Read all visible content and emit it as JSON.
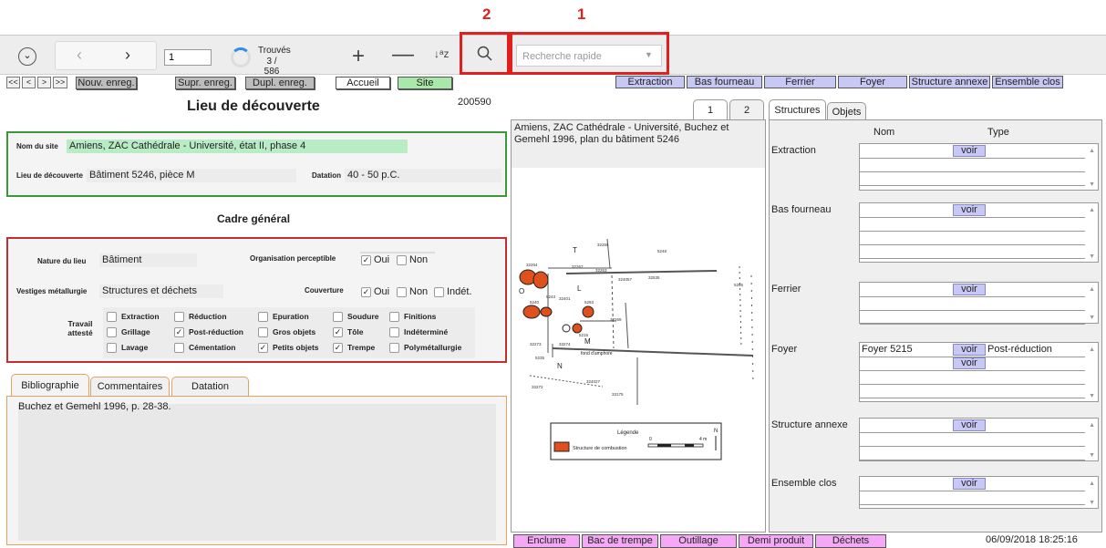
{
  "annotations": {
    "one": "1",
    "two": "2"
  },
  "toolbar": {
    "record_number": "1",
    "found_label": "Trouvés",
    "found_count": "3 / 586",
    "search_placeholder": "Recherche rapide",
    "sort_glyph": "↓ᵃz"
  },
  "nav": {
    "first": "<<",
    "prev": "<",
    "next": ">",
    "last": ">>"
  },
  "buttons": {
    "new": "Nouv. enreg.",
    "delete": "Supr. enreg.",
    "duplicate": "Dupl. enreg.",
    "home": "Accueil",
    "site": "Site"
  },
  "top_tabs": [
    "Extraction",
    "Bas fourneau",
    "Ferrier",
    "Foyer",
    "Structure annexe",
    "Ensemble clos"
  ],
  "record_id": "200590",
  "page_title": "Lieu de découverte",
  "site": {
    "name_label": "Nom du site",
    "name_value": "Amiens, ZAC Cathédrale - Université, état II, phase 4",
    "place_label": "Lieu de découverte",
    "place_value": "Bâtiment 5246, pièce M",
    "date_label": "Datation",
    "date_value": "40 - 50 p.C."
  },
  "cadre": {
    "title": "Cadre général",
    "nature_label": "Nature du lieu",
    "nature_value": "Bâtiment",
    "org_label": "Organisation perceptible",
    "vest_label": "Vestiges métallurgie",
    "vest_value": "Structures et déchets",
    "couv_label": "Couverture",
    "oui": "Oui",
    "non": "Non",
    "indet": "Indét.",
    "travail_label": "Travail attesté",
    "checks": [
      {
        "label": "Extraction",
        "checked": false
      },
      {
        "label": "Réduction",
        "checked": false
      },
      {
        "label": "Epuration",
        "checked": false
      },
      {
        "label": "Soudure",
        "checked": false
      },
      {
        "label": "Finitions",
        "checked": false
      },
      {
        "label": "Grillage",
        "checked": false
      },
      {
        "label": "Post-réduction",
        "checked": true
      },
      {
        "label": "Gros objets",
        "checked": false
      },
      {
        "label": "Tôle",
        "checked": true
      },
      {
        "label": "Indéterminé",
        "checked": false
      },
      {
        "label": "Lavage",
        "checked": false
      },
      {
        "label": "Cémentation",
        "checked": false
      },
      {
        "label": "Petits objets",
        "checked": true
      },
      {
        "label": "Trempe",
        "checked": true
      },
      {
        "label": "Polymétallurgie",
        "checked": false
      }
    ]
  },
  "lower_tabs": [
    "Bibliographie",
    "Commentaires",
    "Datation"
  ],
  "bibliography": "Buchez et Gemehl 1996, p. 28-38.",
  "image_tabs": [
    "1",
    "2"
  ],
  "image_caption": "Amiens, ZAC Cathédrale - Université, Buchez et Gemehl 1996, plan du bâtiment 5246",
  "plan": {
    "legend_title": "Légende",
    "legend_item": "Structure de combustion",
    "north": "N",
    "scale_0": "0",
    "scale_4": "4 m",
    "room_T": "T",
    "room_L": "L",
    "room_M": "M",
    "room_N": "N",
    "room_O": "O",
    "fond": "fond d'amphore",
    "nums": [
      "32264",
      "32266",
      "32267",
      "32263",
      "324057",
      "32535",
      "5248",
      "32401",
      "5243",
      "5240",
      "5283",
      "5215",
      "32269",
      "32273",
      "5235",
      "33274",
      "5286",
      "324027",
      "33272",
      "33175"
    ]
  },
  "right_tabs": [
    "Structures",
    "Objets"
  ],
  "right_headers": {
    "nom": "Nom",
    "type": "Type"
  },
  "sections": [
    {
      "label": "Extraction",
      "rows": []
    },
    {
      "label": "Bas fourneau",
      "rows": []
    },
    {
      "label": "Ferrier",
      "rows": []
    },
    {
      "label": "Foyer",
      "rows": [
        {
          "name": "Foyer 5215",
          "type": "Post-réduction"
        }
      ]
    },
    {
      "label": "Structure annexe",
      "rows": []
    },
    {
      "label": "Ensemble clos",
      "rows": []
    }
  ],
  "voir": "voir",
  "bottom_tabs": [
    "Enclume",
    "Bac de trempe",
    "Outillage",
    "Demi produit",
    "Déchets"
  ],
  "timestamp": "06/09/2018 18:25:16",
  "colors": {
    "site_border": "#3a9a3a",
    "cadre_border": "#c03030",
    "tab_orange": "#e8a060",
    "lavender": "#c8c8f5",
    "pink": "#f5a8f5",
    "site_green": "#a8e8a8",
    "annotation_red": "#e0201c"
  }
}
